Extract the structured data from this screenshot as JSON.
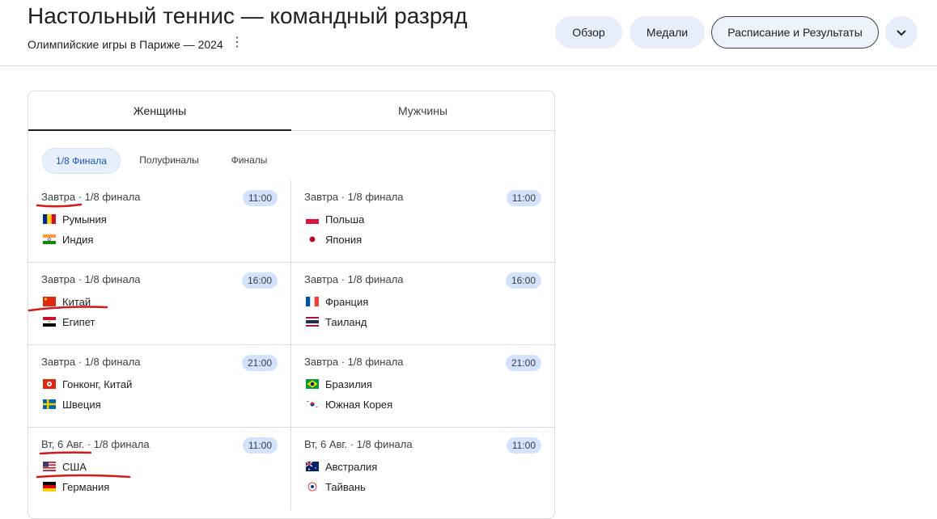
{
  "header": {
    "title": "Настольный теннис — командный разряд",
    "subtitle": "Олимпийские игры в Париже — 2024",
    "chips": [
      "Обзор",
      "Медали",
      "Расписание и Результаты"
    ]
  },
  "tabs": [
    "Женщины",
    "Мужчины"
  ],
  "rounds": [
    "1/8 Финала",
    "Полуфиналы",
    "Финалы"
  ],
  "matches": [
    {
      "head": "Завтра · 1/8 финала",
      "time": "11:00",
      "teams": [
        {
          "name": "Румыния",
          "flag": "romania-flag-icon"
        },
        {
          "name": "Индия",
          "flag": "india-flag-icon"
        }
      ]
    },
    {
      "head": "Завтра · 1/8 финала",
      "time": "11:00",
      "teams": [
        {
          "name": "Польша",
          "flag": "poland-flag-icon"
        },
        {
          "name": "Япония",
          "flag": "japan-flag-icon"
        }
      ]
    },
    {
      "head": "Завтра · 1/8 финала",
      "time": "16:00",
      "teams": [
        {
          "name": "Китай",
          "flag": "china-flag-icon"
        },
        {
          "name": "Египет",
          "flag": "egypt-flag-icon"
        }
      ]
    },
    {
      "head": "Завтра · 1/8 финала",
      "time": "16:00",
      "teams": [
        {
          "name": "Франция",
          "flag": "france-flag-icon"
        },
        {
          "name": "Таиланд",
          "flag": "thailand-flag-icon"
        }
      ]
    },
    {
      "head": "Завтра · 1/8 финала",
      "time": "21:00",
      "teams": [
        {
          "name": "Гонконг, Китай",
          "flag": "hong-kong-flag-icon"
        },
        {
          "name": "Швеция",
          "flag": "sweden-flag-icon"
        }
      ]
    },
    {
      "head": "Завтра · 1/8 финала",
      "time": "21:00",
      "teams": [
        {
          "name": "Бразилия",
          "flag": "brazil-flag-icon"
        },
        {
          "name": "Южная Корея",
          "flag": "south-korea-flag-icon"
        }
      ]
    },
    {
      "head": "Вт, 6 Авг. · 1/8 финала",
      "time": "11:00",
      "teams": [
        {
          "name": "США",
          "flag": "usa-flag-icon"
        },
        {
          "name": "Германия",
          "flag": "germany-flag-icon"
        }
      ]
    },
    {
      "head": "Вт, 6 Авг. · 1/8 финала",
      "time": "11:00",
      "teams": [
        {
          "name": "Австралия",
          "flag": "australia-flag-icon"
        },
        {
          "name": "Тайвань",
          "flag": "chinese-taipei-flag-icon"
        }
      ]
    }
  ],
  "colors": {
    "chip_bg": "#e8eef9",
    "time_bg": "#d3e3fd",
    "ink": "#d11a1a"
  }
}
